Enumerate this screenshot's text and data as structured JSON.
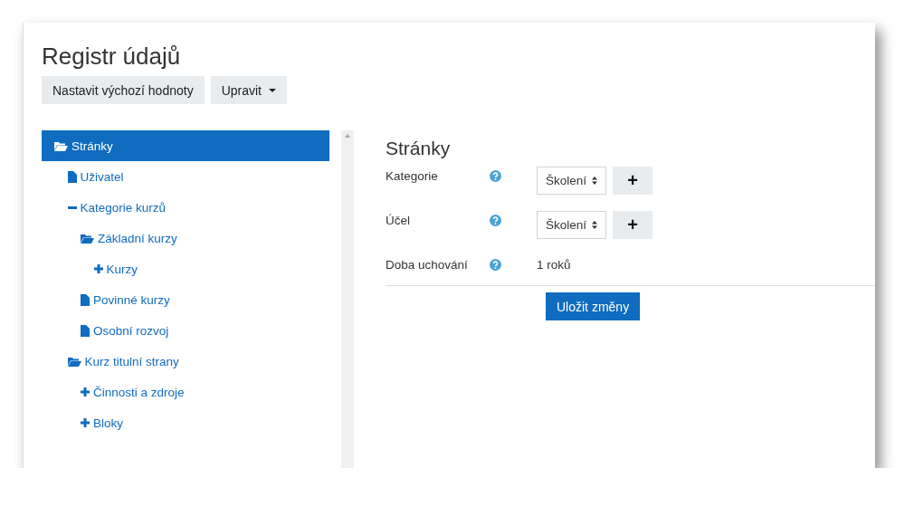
{
  "title": "Registr údajů",
  "toolbar": [
    {
      "label": "Nastavit výchozí hodnoty",
      "kind": "button"
    },
    {
      "label": "Upravit",
      "kind": "dropdown"
    }
  ],
  "tree": [
    {
      "label": "Stránky",
      "kind": "folder",
      "selected": true,
      "children": [
        {
          "label": "Uživatel",
          "kind": "file",
          "selected": false
        },
        {
          "label": "Kategorie kurzů",
          "kind": "minus",
          "selected": false,
          "children": [
            {
              "label": "Základní kurzy",
              "kind": "folder",
              "selected": false,
              "children": [
                {
                  "label": "Kurzy",
                  "kind": "plus",
                  "selected": false
                }
              ]
            },
            {
              "label": "Povinné kurzy",
              "kind": "file",
              "selected": false
            },
            {
              "label": "Osobní rozvoj",
              "kind": "file",
              "selected": false
            }
          ]
        },
        {
          "label": "Kurz titulní strany",
          "kind": "folder",
          "selected": false,
          "children": [
            {
              "label": "Činnosti a zdroje",
              "kind": "plus",
              "selected": false
            },
            {
              "label": "Bloky",
              "kind": "plus",
              "selected": false
            }
          ]
        }
      ]
    }
  ],
  "panel": {
    "heading": "Stránky",
    "fields": [
      {
        "label": "Kategorie",
        "kind": "select",
        "value": "Školení",
        "add": "+"
      },
      {
        "label": "Účel",
        "kind": "select",
        "value": "Školení",
        "add": "+"
      },
      {
        "label": "Doba uchování",
        "kind": "text",
        "value": "1 roků"
      }
    ],
    "save": "Uložit změny"
  }
}
